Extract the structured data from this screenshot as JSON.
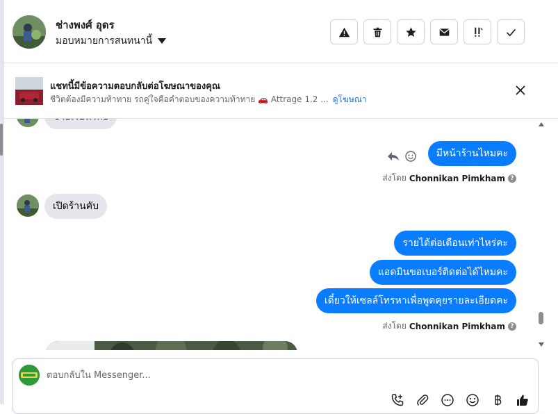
{
  "header": {
    "name": "ช่างพงศ์ อุดร",
    "assign_label": "มอบหมายการสนทนานี้",
    "toolbar": [
      {
        "icon": "warning-icon",
        "name": "report-button"
      },
      {
        "icon": "trash-icon",
        "name": "delete-button"
      },
      {
        "icon": "star-icon",
        "name": "star-button"
      },
      {
        "icon": "envelope-icon",
        "name": "mark-unread-button"
      },
      {
        "icon": "follow-up-icon",
        "name": "follow-up-button"
      },
      {
        "icon": "check-icon",
        "name": "mark-done-button"
      }
    ]
  },
  "ad": {
    "title": "แชทนี้มีข้อความตอบกลับต่อโฆษณาของคุณ",
    "subtitle": "ชีวิตต้องมีความท้าทาย รถคู่ใจคือคำตอบของความท้าทาย 🚗 Attrage 1.2 ...",
    "link": "ดูโฆษณา"
  },
  "messages": {
    "partial_incoming": "ซ้ายเรียนไทย",
    "out1": "มีหน้าร้านไหมคะ",
    "sent_by_prefix": "ส่งโดย",
    "sent_by_name": "Chonnikan Pimkham",
    "in1": "เปิดร้านคับ",
    "out2": "รายได้ต่อเดือนเท่าไหร่คะ",
    "out3": "แอดมินขอเบอร์ติดต่อได้ไหมคะ",
    "out4": "เดี๋ยวให้เซลล์โทรหาเพื่อพูดคุยรายละเอียดคะ"
  },
  "composer": {
    "placeholder": "ตอบกลับใน Messenger..."
  },
  "colors": {
    "outgoing_bubble": "#0a7cff",
    "incoming_bubble": "#e4e6eb",
    "link": "#216fdb"
  }
}
